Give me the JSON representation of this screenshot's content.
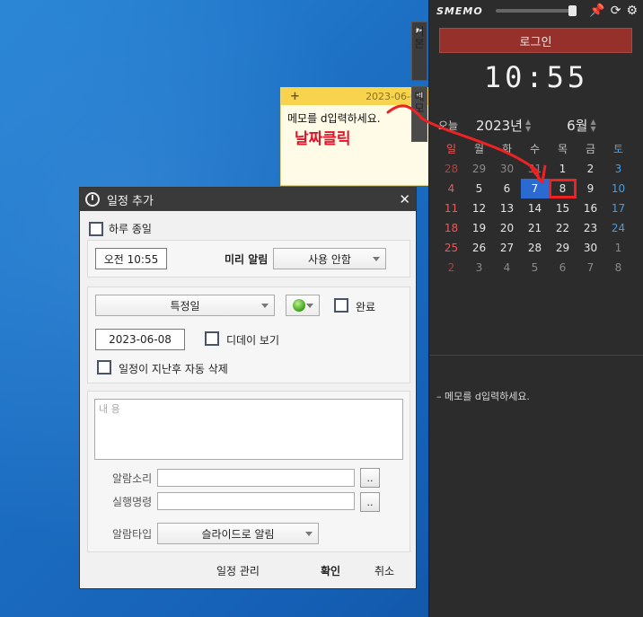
{
  "memo": {
    "add_label": "+",
    "date": "2023-06-07",
    "text": "메모를 d입력하세요.",
    "annotation": "날짜클릭"
  },
  "side_tabs": {
    "tab1": "기본",
    "tab2": "메모"
  },
  "panel": {
    "brand": "SMEMO",
    "login_label": "로그인",
    "clock": "10:55",
    "today_label": "오늘",
    "year": "2023년",
    "month": "6월",
    "memo_item": "– 메모를 d입력하세요."
  },
  "calendar": {
    "weekdays": [
      "일",
      "월",
      "화",
      "수",
      "목",
      "금",
      "토"
    ],
    "weeks": [
      [
        "28",
        "29",
        "30",
        "31",
        "1",
        "2",
        "3"
      ],
      [
        "4",
        "5",
        "6",
        "7",
        "8",
        "9",
        "10"
      ],
      [
        "11",
        "12",
        "13",
        "14",
        "15",
        "16",
        "17"
      ],
      [
        "18",
        "19",
        "20",
        "21",
        "22",
        "23",
        "24"
      ],
      [
        "25",
        "26",
        "27",
        "28",
        "29",
        "30",
        "1"
      ],
      [
        "2",
        "3",
        "4",
        "5",
        "6",
        "7",
        "8"
      ]
    ],
    "today": "7",
    "selected": "8"
  },
  "dialog": {
    "title": "일정 추가",
    "close": "✕",
    "allday_label": "하루 종일",
    "time_value": "오전 10:55",
    "prealarm_label": "미리 알림",
    "prealarm_value": "사용 안함",
    "repeat_value": "특정일",
    "complete_label": "완료",
    "date_value": "2023-06-08",
    "dday_label": "디데이 보기",
    "autodelete_label": "일정이 지난후 자동 삭제",
    "content_placeholder": "내 용",
    "sound_label": "알람소리",
    "command_label": "실행명령",
    "browse_label": "..",
    "alarmtype_label": "알람타입",
    "alarmtype_value": "슬라이드로 알림",
    "manage_label": "일정 관리",
    "ok_label": "확인",
    "cancel_label": "취소"
  }
}
